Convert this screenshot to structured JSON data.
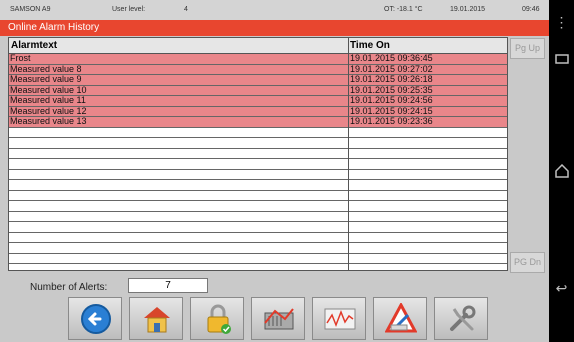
{
  "status": {
    "device": "SAMSON A9",
    "user_level_label": "User level:",
    "user_level": "4",
    "ot": "OT: -18.1 °C",
    "date": "19.01.2015",
    "time": "09:46"
  },
  "title": "Online Alarm History",
  "table": {
    "headers": [
      "Alarmtext",
      "Time On"
    ],
    "rows": [
      {
        "text": "Frost",
        "time": "19.01.2015 09:36:45"
      },
      {
        "text": "Measured value 8",
        "time": "19.01.2015 09:27:02"
      },
      {
        "text": "Measured value 9",
        "time": "19.01.2015 09:26:18"
      },
      {
        "text": "Measured value 10",
        "time": "19.01.2015 09:25:35"
      },
      {
        "text": "Measured value 11",
        "time": "19.01.2015 09:24:56"
      },
      {
        "text": "Measured value 12",
        "time": "19.01.2015 09:24:15"
      },
      {
        "text": "Measured value 13",
        "time": "19.01.2015 09:23:36"
      }
    ],
    "empty_rows": 14
  },
  "pager": {
    "up_label": "Pg Up",
    "down_label": "PG Dn"
  },
  "alerts": {
    "label": "Number of Alerts:",
    "value": "7"
  },
  "toolbar": {
    "buttons": [
      "back-icon",
      "home-icon",
      "lock-icon",
      "heating-circuit-icon",
      "trend-icon",
      "alarm-icon",
      "tools-icon"
    ]
  },
  "navbar": {
    "buttons": [
      "menu-icon",
      "recent-apps-icon",
      "home-icon",
      "back-icon"
    ]
  },
  "colors": {
    "accent": "#e8462f",
    "alarm_row": "#e9868a"
  }
}
